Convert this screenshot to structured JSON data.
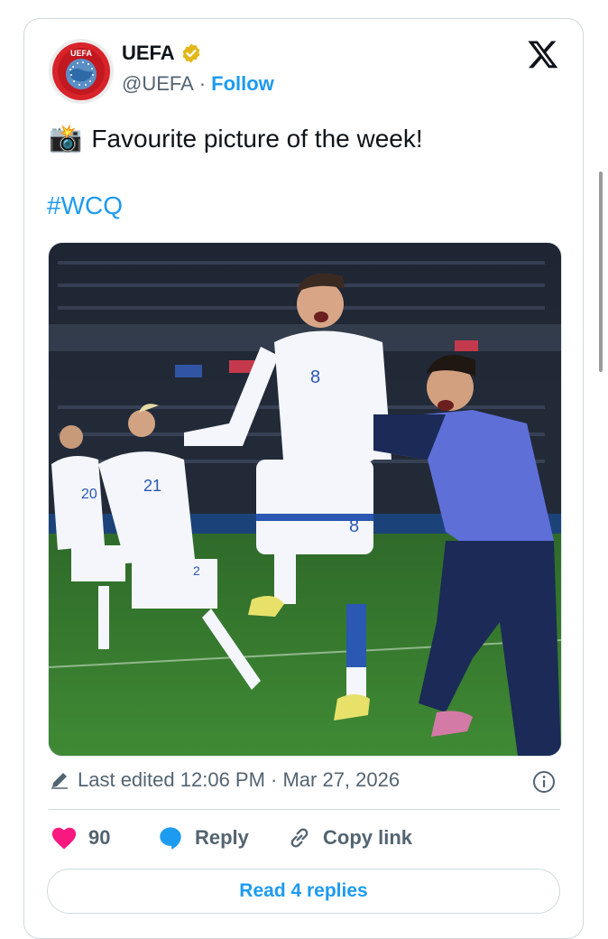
{
  "author": {
    "name": "UEFA",
    "handle": "@UEFA",
    "separator": "·",
    "follow_label": "Follow",
    "avatar_text": "UEFA",
    "verified_color": "#e2b719"
  },
  "tweet": {
    "emoji": "📸",
    "text": "Favourite picture of the week!",
    "hashtag": "#WCQ"
  },
  "media": {
    "jersey_numbers": [
      "8",
      "20",
      "21",
      "2",
      "8"
    ]
  },
  "meta": {
    "edited_label": "Last edited 12:06 PM · Mar 27, 2026"
  },
  "actions": {
    "likes": "90",
    "reply_label": "Reply",
    "copy_link_label": "Copy link"
  },
  "read_replies_label": "Read 4 replies",
  "colors": {
    "accent": "#1d9bf0",
    "like": "#f91880",
    "muted": "#536471"
  }
}
